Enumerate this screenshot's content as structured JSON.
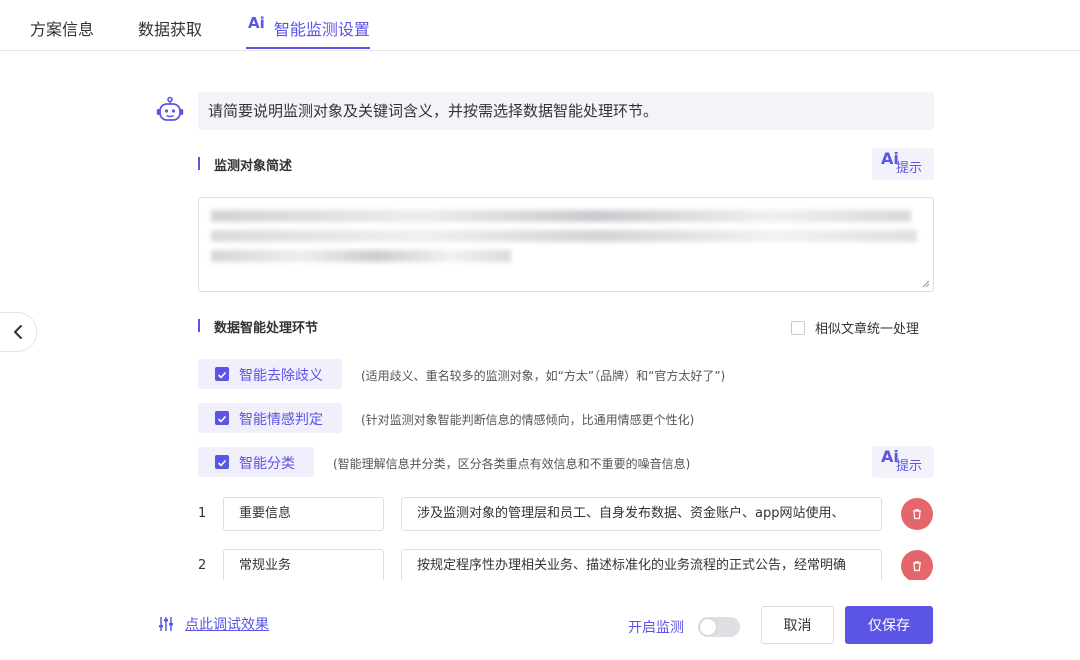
{
  "tabs": [
    {
      "label": "方案信息"
    },
    {
      "label": "数据获取"
    },
    {
      "label": "智能监测设置",
      "ai_badge": "Ai"
    }
  ],
  "prompt_banner": "请简要说明监测对象及关键词含义，并按需选择数据智能处理环节。",
  "object_section": {
    "title": "监测对象简述",
    "hint_badge": "Ai",
    "hint_label": "提示"
  },
  "processing_section": {
    "title": "数据智能处理环节",
    "similar_label": "相似文章统一处理",
    "similar_checked": false,
    "options": [
      {
        "label": "智能去除歧义",
        "checked": true,
        "desc": "(适用歧义、重名较多的监测对象，如“方太”（品牌）和“官方太好了”)"
      },
      {
        "label": "智能情感判定",
        "checked": true,
        "desc": "(针对监测对象智能判断信息的情感倾向，比通用情感更个性化)"
      },
      {
        "label": "智能分类",
        "checked": true,
        "desc": "(智能理解信息并分类，区分各类重点有效信息和不重要的噪音信息)"
      }
    ],
    "hint_badge": "Ai",
    "hint_label": "提示"
  },
  "categories": [
    {
      "index": "1",
      "name": "重要信息",
      "desc": "涉及监测对象的管理层和员工、自身发布数据、资金账户、app网站使用、"
    },
    {
      "index": "2",
      "name": "常规业务",
      "desc": "按规定程序性办理相关业务、描述标准化的业务流程的正式公告，经常明确"
    }
  ],
  "footer": {
    "debug_link": "点此调试效果",
    "monitor_label": "开启监测",
    "monitor_on": false,
    "cancel_label": "取消",
    "save_label": "仅保存"
  },
  "colors": {
    "accent": "#5b55e6",
    "danger": "#e4666a"
  }
}
